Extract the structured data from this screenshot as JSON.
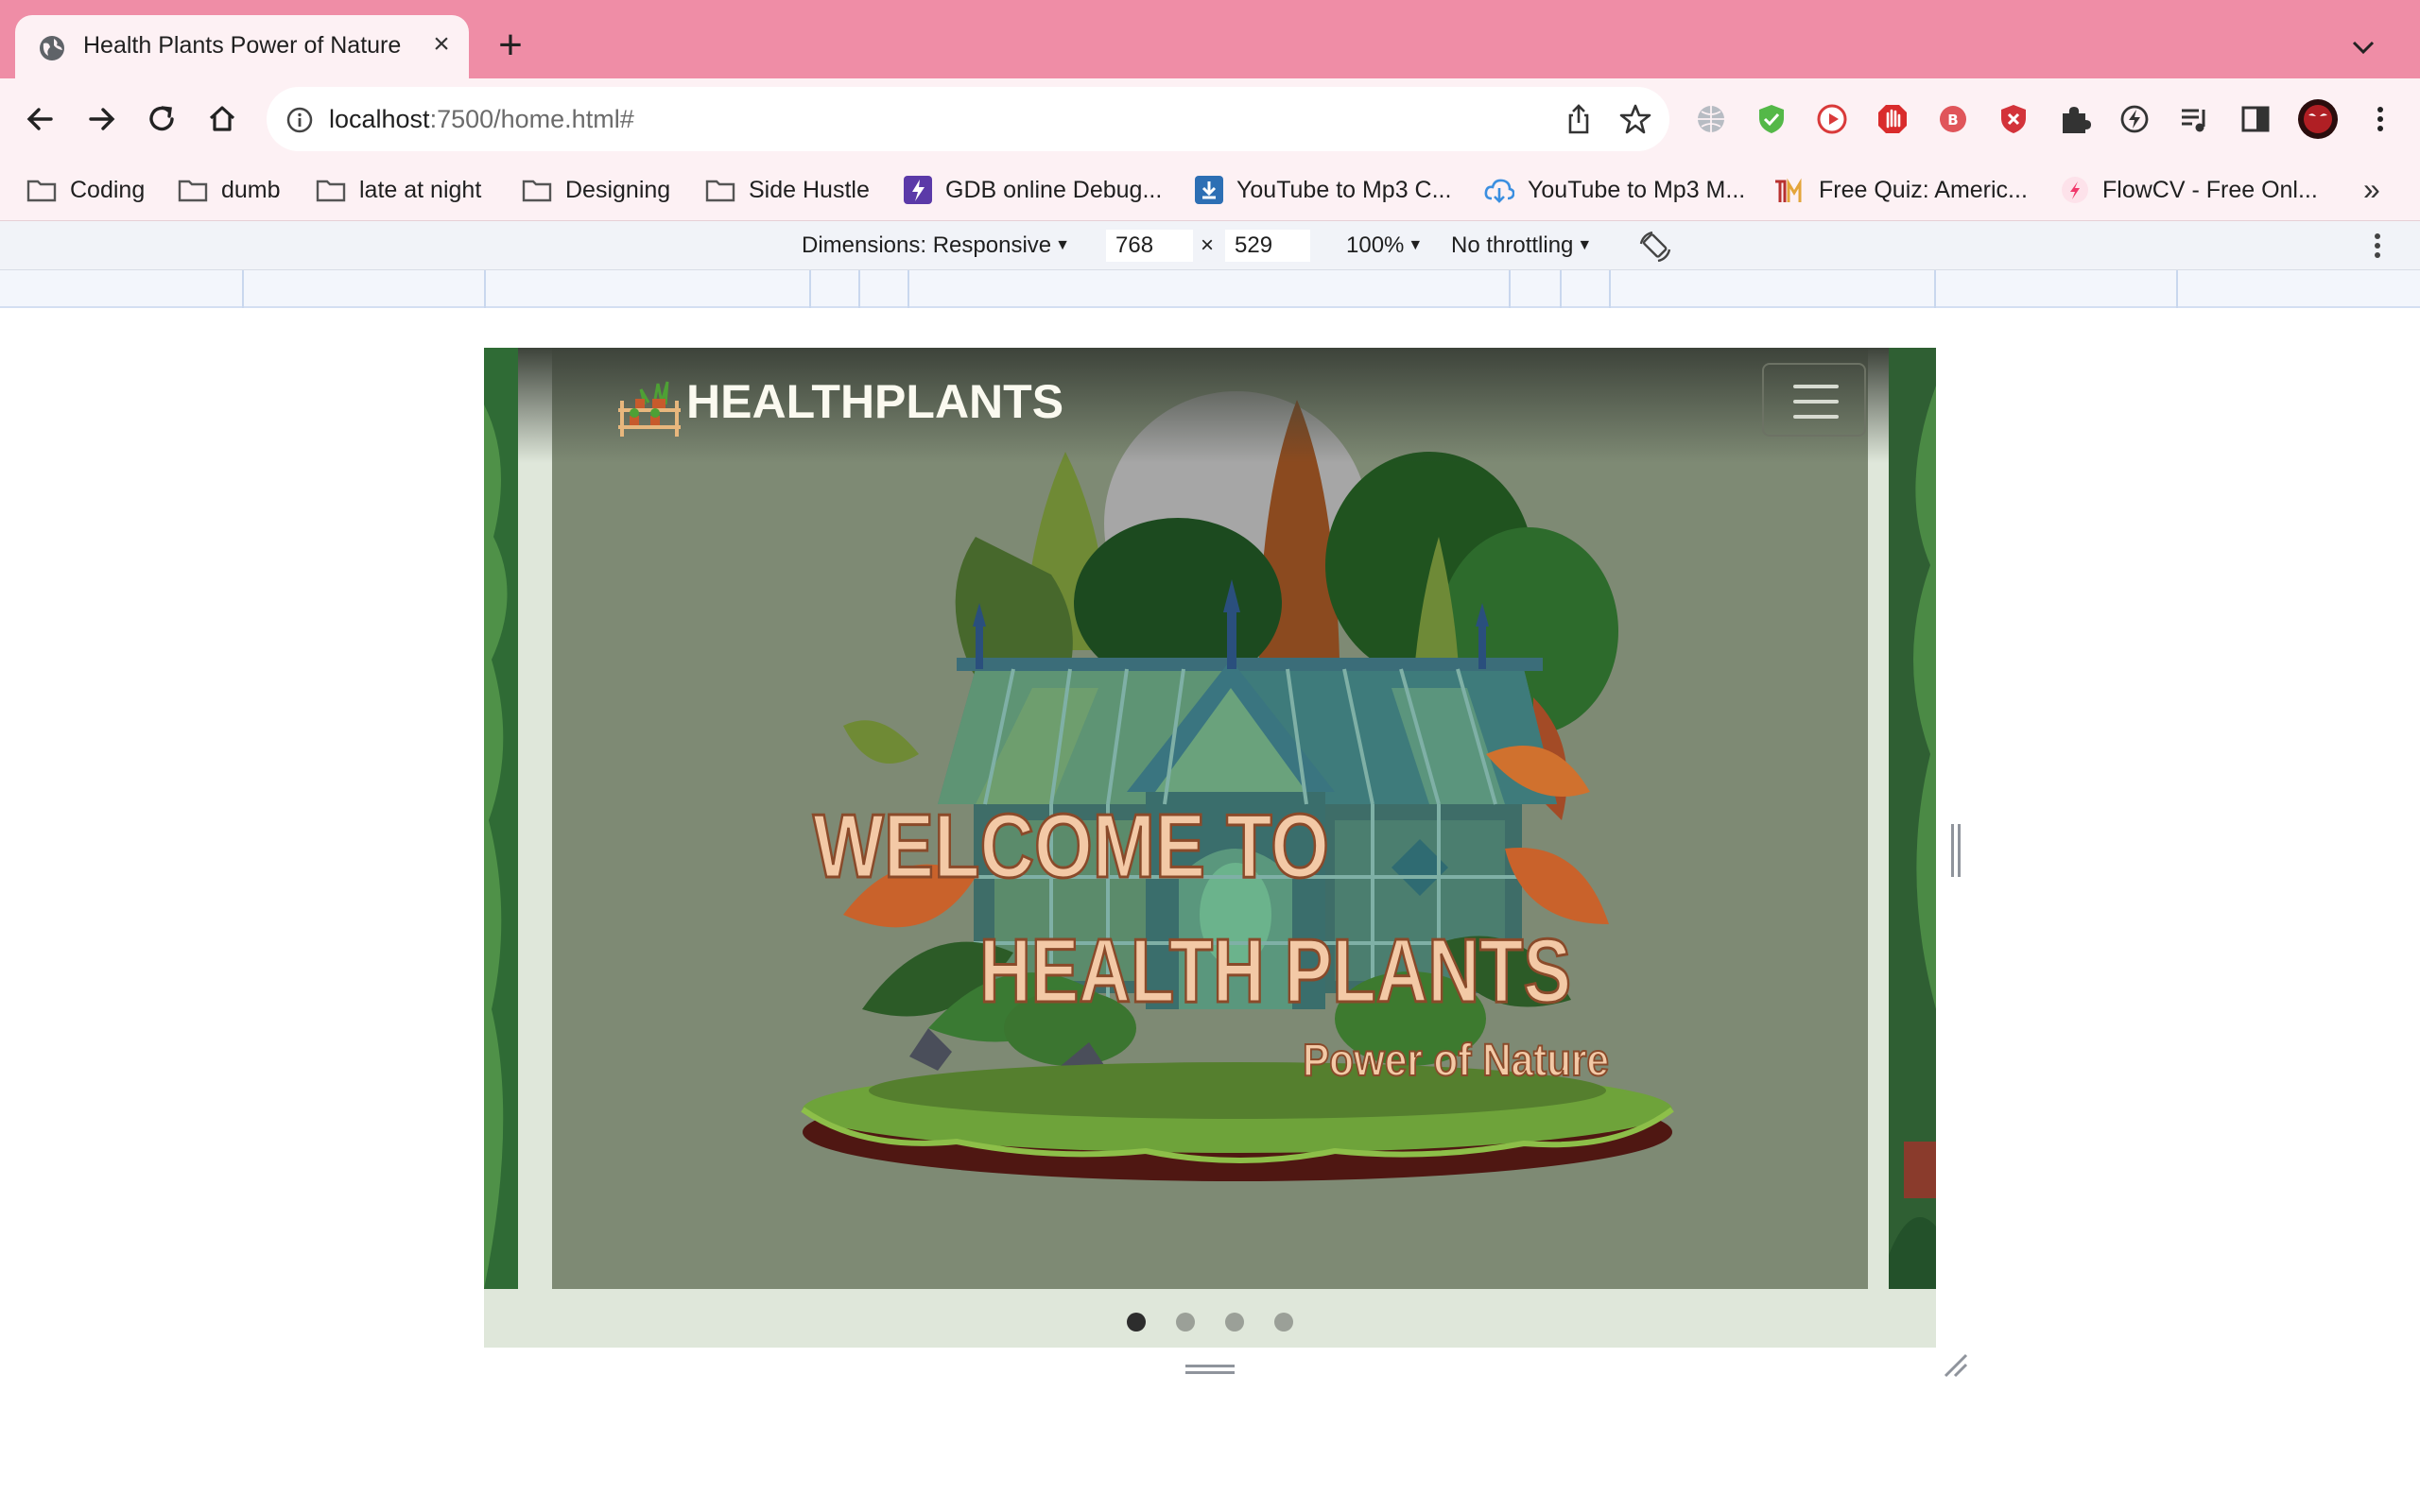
{
  "browser": {
    "tab_title": "Health Plants Power of Nature",
    "url_host": "localhost",
    "url_rest": ":7500/home.html#",
    "bookmarks": [
      {
        "label": "Coding",
        "icon": "folder-icon"
      },
      {
        "label": "dumb",
        "icon": "folder-icon"
      },
      {
        "label": "late at night",
        "icon": "folder-icon"
      },
      {
        "label": "Designing",
        "icon": "folder-icon"
      },
      {
        "label": "Side Hustle",
        "icon": "folder-icon"
      },
      {
        "label": "GDB online Debug...",
        "icon": "gdb-icon"
      },
      {
        "label": "YouTube to Mp3 C...",
        "icon": "download-icon"
      },
      {
        "label": "YouTube to Mp3 M...",
        "icon": "cloud-download-icon"
      },
      {
        "label": "Free Quiz: Americ...",
        "icon": "quiz-icon"
      },
      {
        "label": "FlowCV - Free Onl...",
        "icon": "flowcv-icon"
      }
    ],
    "more_bookmarks": "»"
  },
  "devtools": {
    "dimensions_label": "Dimensions: Responsive",
    "width": "768",
    "times": "×",
    "height": "529",
    "zoom": "100%",
    "throttling": "No throttling"
  },
  "site": {
    "brand": "HEALTHPLANTS",
    "hero": {
      "line1": "WELCOME TO",
      "line2": "HEALTH PLANTS",
      "line3": "Power of Nature"
    },
    "carousel": {
      "slides": 4,
      "active": 1
    }
  },
  "colors": {
    "tabstrip": "#ef8da6",
    "toolbar": "#fdf1f4",
    "hero_bg": "#7e8a74",
    "hero_text": "#f3c9a6"
  }
}
